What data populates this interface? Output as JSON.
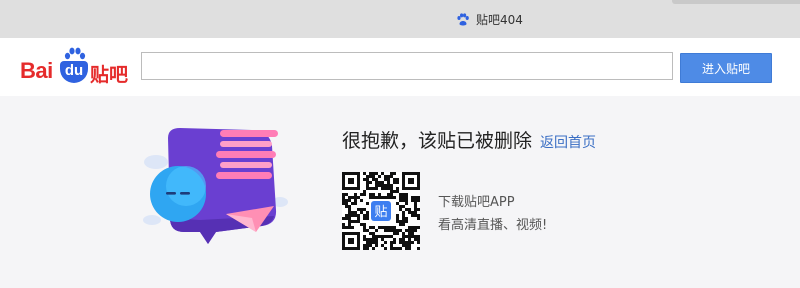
{
  "browser": {
    "tab_title": "贴吧404",
    "tab_icon": "baidu-paw-icon"
  },
  "header": {
    "logo_bai": "Bai",
    "logo_du": "du",
    "logo_tieba": "贴吧",
    "search_value": "",
    "enter_button_label": "进入贴吧"
  },
  "main": {
    "message": "很抱歉，该贴已被删除",
    "back_link": "返回首页",
    "app_line1": "下载贴吧APP",
    "app_line2": "看高清直播、视频!",
    "qr_center_label": "贴"
  },
  "colors": {
    "brand_red": "#e52b2b",
    "brand_blue": "#2f62e0",
    "button_blue": "#4e8be6",
    "link_blue": "#3b6fc4"
  }
}
